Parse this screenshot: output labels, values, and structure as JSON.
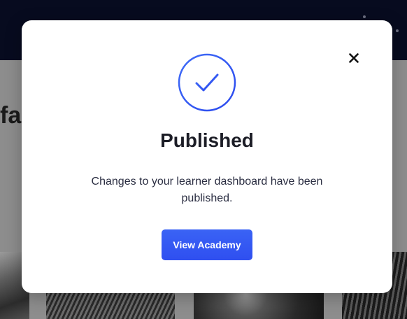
{
  "background": {
    "title_fragment": "fa"
  },
  "modal": {
    "icon": "check-circle-icon",
    "close_icon": "close-icon",
    "title": "Published",
    "message": "Changes to your learner dashboard have been published.",
    "primary_button_label": "View Academy"
  },
  "colors": {
    "accent": "#3355f2",
    "title_text": "#1c1d26",
    "body_text": "#2b2e42",
    "header_background": "#070b1f"
  }
}
